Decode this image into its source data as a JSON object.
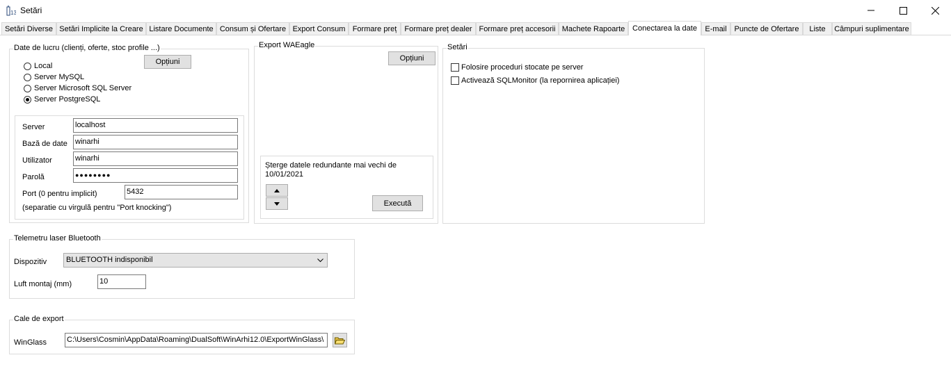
{
  "window": {
    "title": "Setări"
  },
  "tabs": [
    "Setări Diverse",
    "Setări Implicite la Creare",
    "Listare Documente",
    "Consum și Ofertare",
    "Export Consum",
    "Formare preț",
    "Formare preț dealer",
    "Formare preț accesorii",
    "Machete Rapoarte",
    "Conectarea la date",
    "E-mail",
    "Puncte de Ofertare",
    "Liste",
    "Câmpuri suplimentare"
  ],
  "data_group": {
    "title": "Date de lucru (clienți, oferte, stoc profile ...)",
    "options_button": "Opțiuni",
    "radios": [
      "Local",
      "Server MySQL",
      "Server Microsoft SQL Server",
      "Server PostgreSQL"
    ],
    "selected": "Server PostgreSQL",
    "server_label": "Server",
    "server_value": "localhost",
    "db_label": "Bază de date",
    "db_value": "winarhi",
    "user_label": "Utilizator",
    "user_value": "winarhi",
    "password_label": "Parolă",
    "password_value": "●●●●●●●●",
    "port_label": "Port (0 pentru implicit)",
    "port_value": "5432",
    "port_note": "(separatie cu virgulă pentru \"Port knocking\")"
  },
  "export_group": {
    "title": "Export WAEagle",
    "options_button": "Opțiuni",
    "delete_text_1": "Șterge datele redundante mai vechi de",
    "delete_date": "10/01/2021",
    "up_icon": "up-arrow",
    "down_icon": "down-arrow",
    "execute_button": "Execută"
  },
  "settings_group": {
    "title": "Setări",
    "checkbox_1": "Folosire proceduri stocate pe server",
    "checkbox_2": "Activează SQLMonitor (la repornirea aplicației)"
  },
  "bluetooth_group": {
    "title": "Telemetru laser Bluetooth",
    "device_label": "Dispozitiv",
    "device_value": "BLUETOOTH indisponibil",
    "luft_label": "Luft montaj (mm)",
    "luft_value": "10"
  },
  "export_path_group": {
    "title": "Cale de export",
    "winglass_label": "WinGlass",
    "winglass_value": "C:\\Users\\Cosmin\\AppData\\Roaming\\DualSoft\\WinArhi12.0\\ExportWinGlass\\"
  }
}
